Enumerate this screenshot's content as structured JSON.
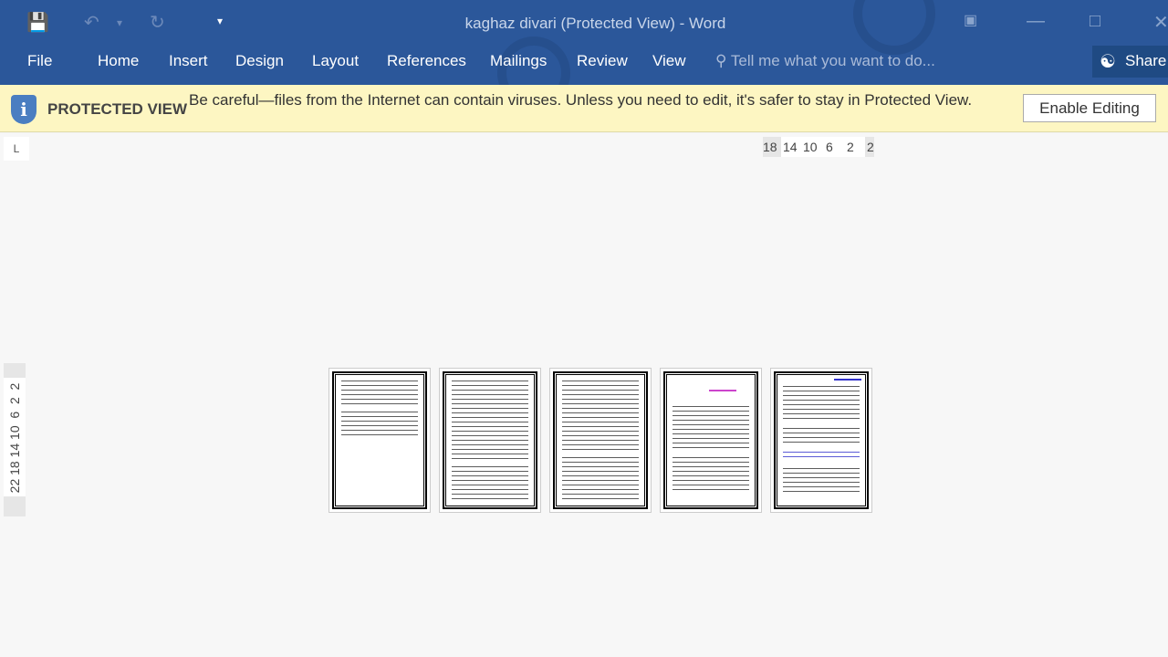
{
  "window": {
    "title": "kaghaz divari (Protected View) - Word"
  },
  "quick_access": {
    "save": "save-icon",
    "undo": "undo-icon",
    "redo": "redo-icon",
    "customize": "customize-icon"
  },
  "ribbon": {
    "tabs": [
      "File",
      "Home",
      "Insert",
      "Design",
      "Layout",
      "References",
      "Mailings",
      "Review",
      "View"
    ],
    "tell_me": "Tell me what you want to do...",
    "share": "Share"
  },
  "protected_view": {
    "label": "PROTECTED VIEW",
    "message": "Be careful—files from the Internet can contain viruses. Unless you need to edit, it's safer to stay in Protected View.",
    "button": "Enable Editing",
    "icon": "i"
  },
  "rulers": {
    "tab_selector": "L",
    "horizontal": [
      "18",
      "14",
      "10",
      "6",
      "2",
      "2"
    ],
    "vertical": "22 18 14 10  6  2  2"
  },
  "colors": {
    "ribbon": "#2b579a",
    "bar": "#fdf6c2"
  },
  "pages": 5
}
